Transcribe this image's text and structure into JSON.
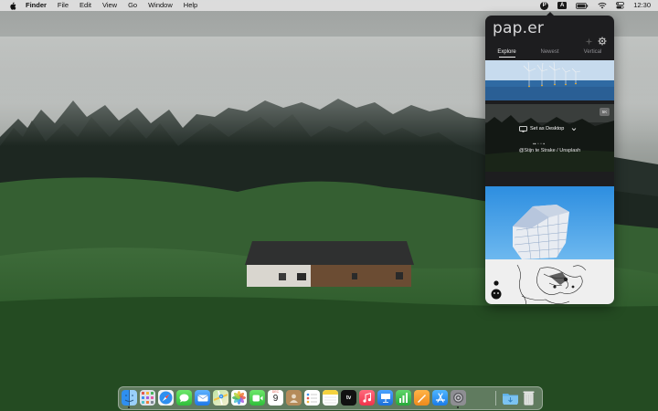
{
  "menubar": {
    "apple_icon": "apple-logo-icon",
    "app_name": "Finder",
    "menus": [
      "File",
      "Edit",
      "View",
      "Go",
      "Window",
      "Help"
    ],
    "status_icons": [
      "paper-menubar-icon",
      "input-source-icon",
      "battery-icon",
      "wifi-icon",
      "control-center-icon"
    ],
    "paper_glyph": "P",
    "input_source_label": "A",
    "clock": "12:30"
  },
  "popover": {
    "app_title": "pap.er",
    "toolbar_icons": [
      "sparkle-icon",
      "gear-icon"
    ],
    "tabs": [
      "Explore",
      "Newest",
      "Vertical"
    ],
    "active_tab": "Explore",
    "hover_item": {
      "resolution_badge": "5K",
      "set_desktop_label": "Set as Desktop",
      "credit": "@Stijn te Strake / Unsplash"
    }
  },
  "dock": {
    "apps": [
      "finder-icon",
      "launchpad-icon",
      "safari-icon",
      "messages-icon",
      "mail-icon",
      "maps-icon",
      "photos-icon",
      "facetime-icon",
      "calendar-icon",
      "contacts-icon",
      "reminders-icon",
      "notes-icon",
      "apple-tv-icon",
      "music-icon",
      "keynote-icon",
      "numbers-icon",
      "pages-icon",
      "app-store-icon",
      "system-preferences-icon",
      "downloads-folder-icon",
      "trash-icon"
    ],
    "calendar_day": "9",
    "calendar_month": "DEC",
    "tv_label": "tv"
  },
  "colors": {
    "menubar_bg": "#e1e1e1",
    "popover_bg": "#1d1d1f",
    "accent_active_tab": "#f0f0f0"
  }
}
